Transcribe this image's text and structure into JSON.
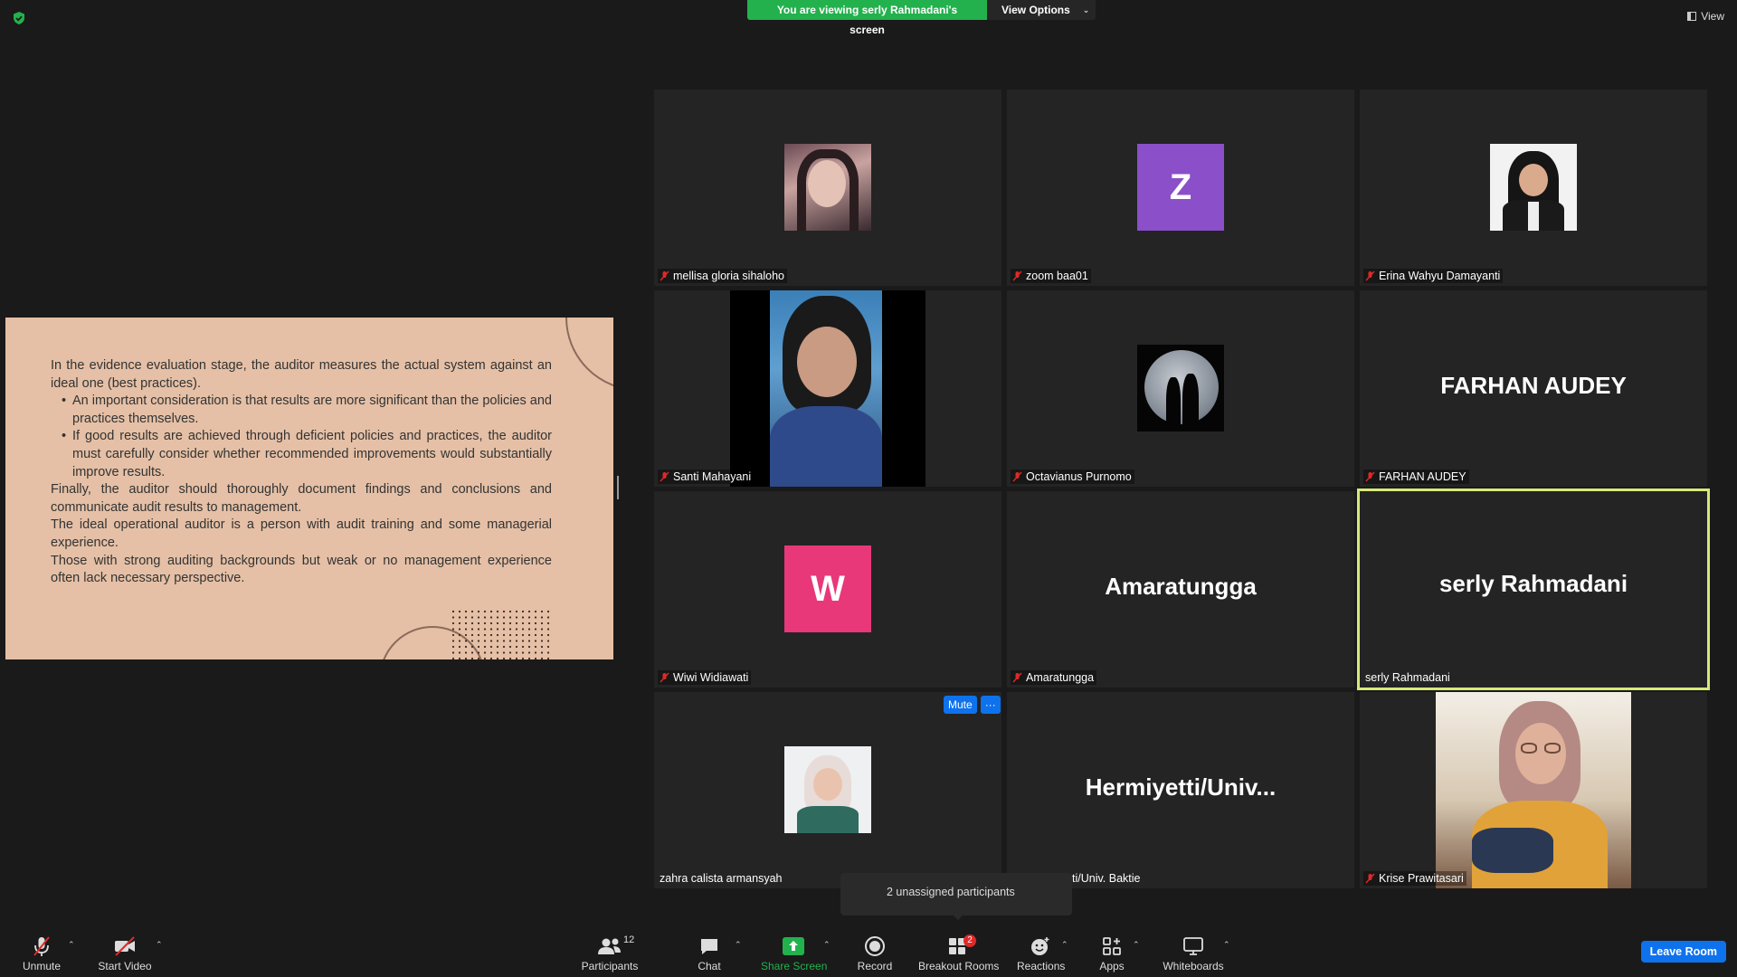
{
  "top_bar": {
    "viewing_label": "You are viewing serly Rahmadani's screen",
    "view_options_label": "View Options",
    "view_label": "View"
  },
  "slide": {
    "paragraph_1": "In the evidence evaluation stage, the auditor measures the actual system against an ideal one (best practices).",
    "bullet_1": "An important consideration is that results are more significant than the policies and practices themselves.",
    "bullet_2": "If good results are achieved through deficient policies and practices, the auditor must carefully consider whether recommended improvements would substantially improve results.",
    "paragraph_2": "Finally, the auditor should thoroughly document findings and conclusions and communicate audit results to management.",
    "paragraph_3": "The ideal operational auditor is a person with audit training and some managerial experience.",
    "paragraph_4": "Those with strong auditing backgrounds but weak or no management experience often lack necessary perspective."
  },
  "participants": [
    {
      "name": "mellisa gloria sihaloho",
      "muted": true
    },
    {
      "name": "zoom baa01",
      "muted": true,
      "avatar_letter": "Z",
      "avatar_color": "#8b4fc9"
    },
    {
      "name": "Erina Wahyu Damayanti",
      "muted": true
    },
    {
      "name": "Santi Mahayani",
      "muted": true
    },
    {
      "name": "Octavianus Purnomo",
      "muted": true
    },
    {
      "name": "FARHAN AUDEY",
      "muted": true,
      "display": "FARHAN AUDEY"
    },
    {
      "name": "Wiwi Widiawati",
      "muted": true,
      "avatar_letter": "W",
      "avatar_color": "#e8387a"
    },
    {
      "name": "Amaratungga",
      "muted": true,
      "display": "Amaratungga"
    },
    {
      "name": "serly Rahmadani",
      "muted": false,
      "display": "serly Rahmadani",
      "active_speaker": true
    },
    {
      "name": "zahra calista armansyah",
      "muted": false
    },
    {
      "name": "ti/Univ. Baktie",
      "muted": false,
      "display": "Hermiyetti/Univ..."
    },
    {
      "name": "Krise Prawitasari",
      "muted": true
    }
  ],
  "tile_hover": {
    "mute_label": "Mute",
    "more_label": "···"
  },
  "breakout_tooltip": "2 unassigned participants",
  "toolbar": {
    "unmute": "Unmute",
    "start_video": "Start Video",
    "participants": "Participants",
    "participants_count": "12",
    "chat": "Chat",
    "share_screen": "Share Screen",
    "record": "Record",
    "breakout_rooms": "Breakout Rooms",
    "breakout_count": "2",
    "reactions": "Reactions",
    "apps": "Apps",
    "whiteboards": "Whiteboards",
    "leave_room": "Leave Room"
  },
  "colors": {
    "share_green": "#23b14d",
    "accent_blue": "#0e72ed",
    "active_speaker": "#d8e87a",
    "slide_bg": "#e5c0a6"
  }
}
